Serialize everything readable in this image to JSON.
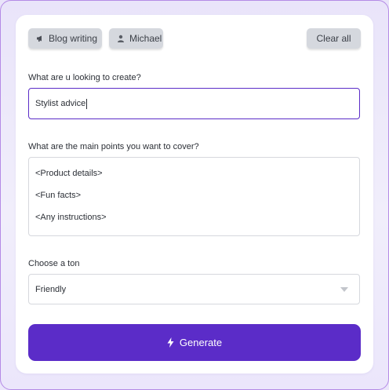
{
  "chips": {
    "topic_label": "Blog writing",
    "topic_icon": "megaphone-icon",
    "user_label": "Michael",
    "user_icon": "user-icon",
    "clear_label": "Clear all"
  },
  "form": {
    "title_label": "What are u looking to create?",
    "title_value": "Stylist advice",
    "points_label": "What are the main points you want to cover?",
    "points": [
      "<Product details>",
      "<Fun facts>",
      "<Any instructions>"
    ],
    "tone_label": "Choose a ton",
    "tone_value": "Friendly",
    "tone_icon": "chevron-down-icon"
  },
  "actions": {
    "generate_label": "Generate",
    "generate_icon": "lightning-icon"
  },
  "colors": {
    "accent": "#5b2cc8",
    "chip_bg": "#d5d8de",
    "frame_border": "#b48ae6"
  }
}
